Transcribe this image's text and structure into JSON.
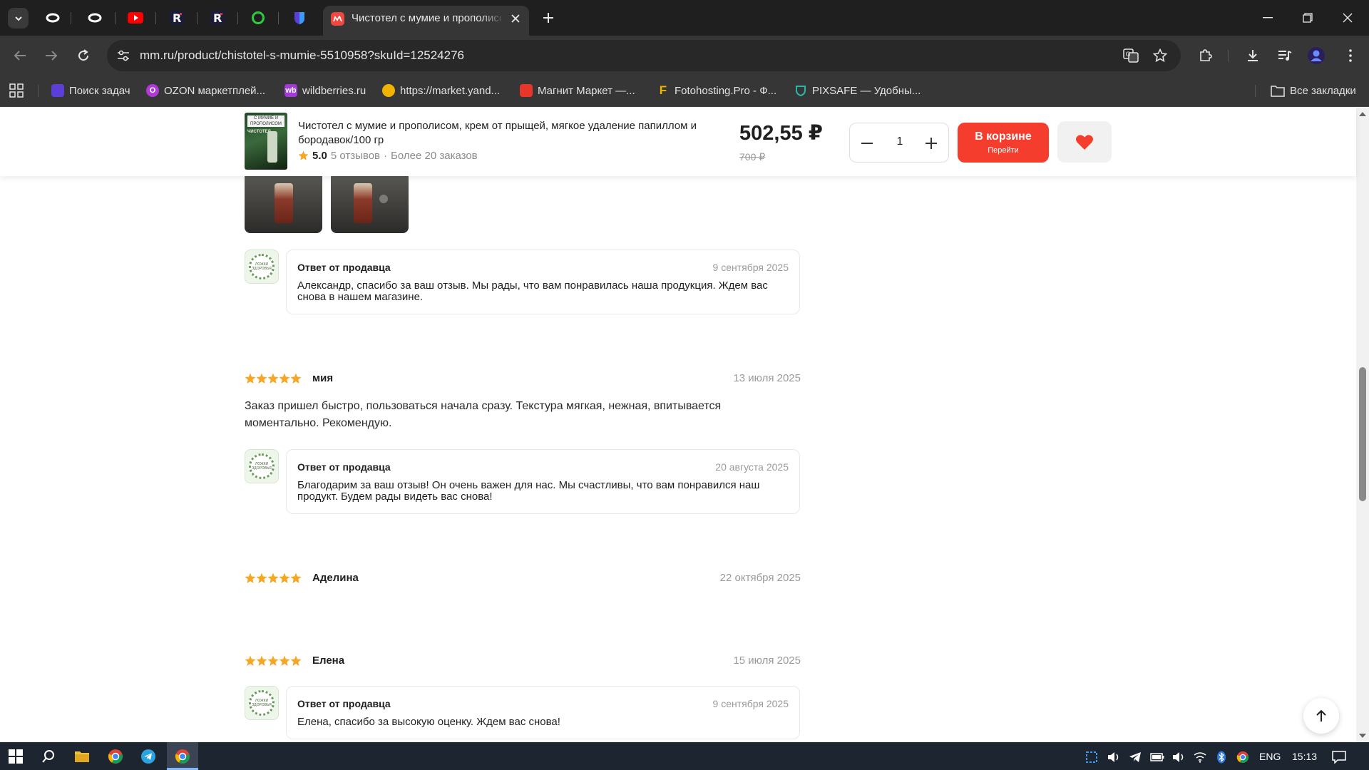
{
  "browser": {
    "active_tab_title": "Чистотел с мумие и прополисом, крем от прыщей",
    "url": "mm.ru/product/chistotel-s-mumie-5510958?skuId=12524276",
    "bookmarks": [
      {
        "label": "Поиск задач",
        "icon": "purple-shield-icon",
        "color": "#5b3fd6"
      },
      {
        "label": "OZON маркетплей...",
        "icon": "ozon-icon",
        "color": "#b03ad6"
      },
      {
        "label": "wildberries.ru",
        "icon": "wb-icon",
        "color": "#a23ad6"
      },
      {
        "label": "https://market.yand...",
        "icon": "yandex-market-icon",
        "color": "#f0b400"
      },
      {
        "label": "Магнит Маркет —...",
        "icon": "magnit-icon",
        "color": "#e8372a"
      },
      {
        "label": "Fotohosting.Pro - Ф...",
        "icon": "fotohosting-icon",
        "color": "#f0b400"
      },
      {
        "label": "PIXSAFE — Удобны...",
        "icon": "pixsafe-icon",
        "color": "#2ab5a5"
      }
    ],
    "all_bookmarks": "Все закладки"
  },
  "product": {
    "name": "Чистотел с мумие и прополисом, крем от прыщей, мягкое удаление папиллом и бородавок/100 гр",
    "thumb_caption": "С МУМИЕ И ПРОПОЛИСОМ",
    "thumb_brand": "ЧИСТОТЕЛ",
    "rating": "5.0",
    "reviews": "5 отзывов",
    "orders": "Более 20 заказов",
    "price": "502,55 ₽",
    "old_price": "700 ₽",
    "quantity": "1",
    "cart_label": "В корзине",
    "cart_sublabel": "Перейти"
  },
  "seller_name_small": "ЛОЖКИ ЗДОРОВЬЯ",
  "replies": [
    {
      "header": "Ответ от продавца",
      "date": "9 сентября 2025",
      "text": "Александр, спасибо за ваш отзыв. Мы рады, что вам понравилась наша продукция. Ждем вас снова в нашем магазине."
    },
    {
      "header": "Ответ от продавца",
      "date": "20 августа 2025",
      "text": "Благодарим за ваш отзыв! Он очень важен для нас. Мы счастливы, что вам понравился наш продукт. Будем рады видеть вас снова!"
    },
    {
      "header": "Ответ от продавца",
      "date": "9 сентября 2025",
      "text": "Елена, спасибо за высокую оценку. Ждем вас снова!"
    }
  ],
  "reviews": [
    {
      "author": "мия",
      "date": "13 июля 2025",
      "rating": 5,
      "text": "Заказ пришел быстро, пользоваться начала сразу. Текстура мягкая, нежная, впитывается моментально. Рекомендую."
    },
    {
      "author": "Аделина",
      "date": "22 октября 2025",
      "rating": 5,
      "text": ""
    },
    {
      "author": "Елена",
      "date": "15 июля 2025",
      "rating": 5,
      "text": ""
    }
  ],
  "taskbar": {
    "lang": "ENG",
    "time": "15:13"
  },
  "colors": {
    "accent": "#f53d2d",
    "star": "#f5a623",
    "chrome_dark": "#1f1f1f",
    "toolbar": "#363636"
  }
}
